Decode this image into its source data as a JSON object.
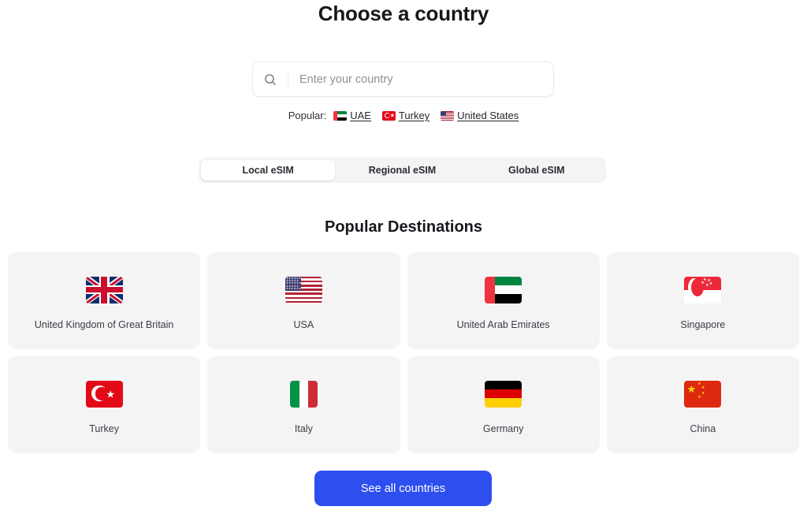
{
  "header": {
    "title": "Choose a country"
  },
  "search": {
    "placeholder": "Enter your country",
    "value": "",
    "icon": "search-icon"
  },
  "popular": {
    "label": "Popular:",
    "links": [
      {
        "label": "UAE",
        "flag": "united-arab-emirates-flag-icon"
      },
      {
        "label": "Turkey",
        "flag": "turkey-flag-icon"
      },
      {
        "label": "United States",
        "flag": "united-states-flag-icon"
      }
    ]
  },
  "tabs": {
    "items": [
      {
        "label": "Local eSIM",
        "active": true
      },
      {
        "label": "Regional eSIM",
        "active": false
      },
      {
        "label": "Global eSIM",
        "active": false
      }
    ]
  },
  "destinations": {
    "heading": "Popular Destinations",
    "cards": [
      {
        "label": "United Kingdom of Great Britain",
        "flag": "united-kingdom-flag-icon"
      },
      {
        "label": "USA",
        "flag": "united-states-flag-icon"
      },
      {
        "label": "United Arab Emirates",
        "flag": "united-arab-emirates-flag-icon"
      },
      {
        "label": "Singapore",
        "flag": "singapore-flag-icon"
      },
      {
        "label": "Turkey",
        "flag": "turkey-flag-icon"
      },
      {
        "label": "Italy",
        "flag": "italy-flag-icon"
      },
      {
        "label": "Germany",
        "flag": "germany-flag-icon"
      },
      {
        "label": "China",
        "flag": "china-flag-icon"
      }
    ]
  },
  "cta": {
    "label": "See all countries",
    "color": "#2d4ff0"
  },
  "colors": {
    "page_background": "#ffffff",
    "card_background": "#f4f4f5",
    "tabbar_background": "#f4f4f5",
    "active_tab_background": "#ffffff",
    "title_text": "#16181c",
    "body_text": "#3a3d44",
    "placeholder_text": "#8e9199",
    "accent": "#2d4ff0"
  }
}
